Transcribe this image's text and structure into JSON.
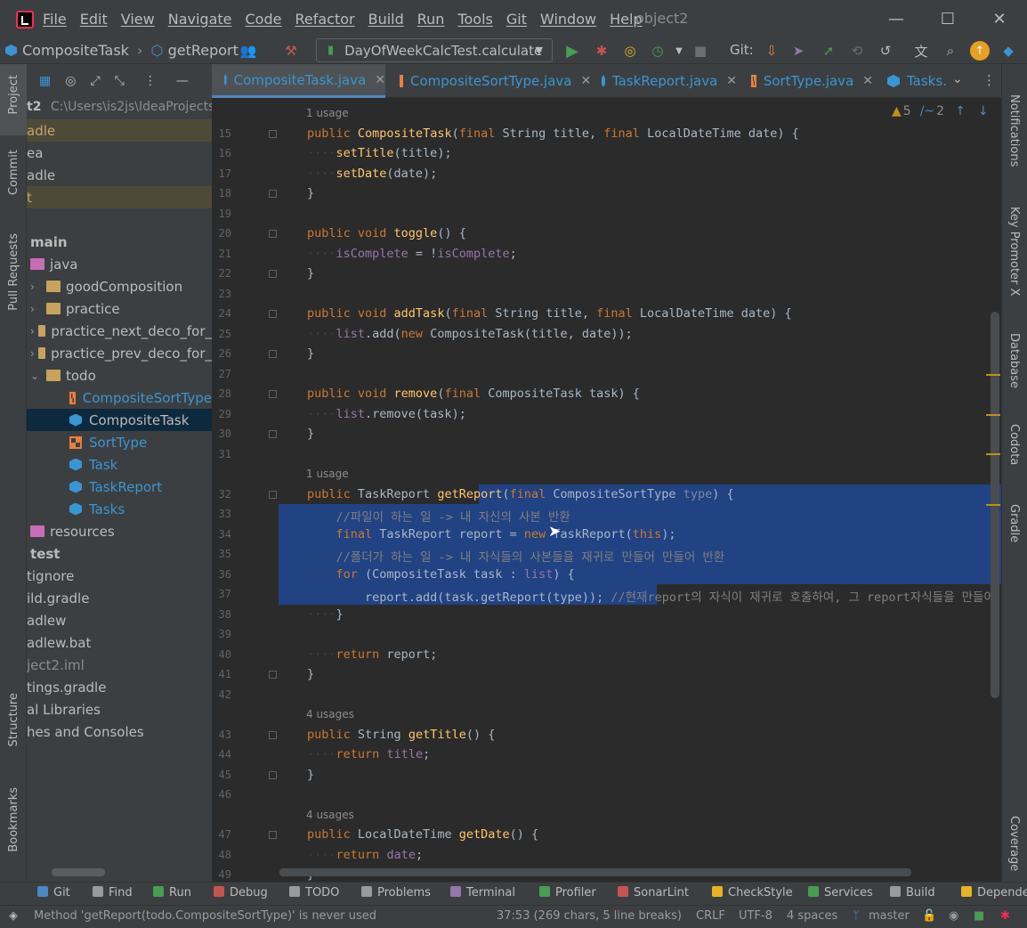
{
  "window": {
    "menu": [
      "File",
      "Edit",
      "View",
      "Navigate",
      "Code",
      "Refactor",
      "Build",
      "Run",
      "Tools",
      "Git",
      "Window",
      "Help"
    ],
    "title": "object2",
    "minimize": "—",
    "maximize": "☐",
    "close": "✕"
  },
  "nav": {
    "crumb_class": "CompositeTask",
    "crumb_sep": "›",
    "crumb_method": "getReport",
    "run_config": "DayOfWeekCalcTest.calculate",
    "git_label": "Git:"
  },
  "left_strip": {
    "project": "Project",
    "commit": "Commit",
    "pull_requests": "Pull Requests",
    "structure": "Structure",
    "bookmarks": "Bookmarks"
  },
  "right_strip": {
    "notifications": "Notifications",
    "key_promoter": "Key Promoter X",
    "database": "Database",
    "codota": "Codota",
    "gradle": "Gradle",
    "coverage": "Coverage"
  },
  "project_tree": {
    "root_prefix": "t2",
    "root_path": "C:\\Users\\is2js\\IdeaProjects",
    "rows": [
      {
        "label": "adle",
        "indent": 0,
        "type": "text",
        "hl": "olive"
      },
      {
        "label": "ea",
        "indent": 0,
        "type": "text",
        "hl": ""
      },
      {
        "label": "adle",
        "indent": 0,
        "type": "text",
        "hl": ""
      },
      {
        "label": "t",
        "indent": 0,
        "type": "text",
        "hl": "olive"
      },
      {
        "label": "",
        "indent": 0,
        "type": "text",
        "hl": ""
      },
      {
        "label": "main",
        "indent": 4,
        "type": "bold",
        "hl": ""
      },
      {
        "label": "java",
        "indent": 4,
        "type": "java-folder",
        "hl": ""
      },
      {
        "label": "goodComposition",
        "indent": 4,
        "type": "folder",
        "arrow": "›",
        "hl": ""
      },
      {
        "label": "practice",
        "indent": 4,
        "type": "folder",
        "arrow": "›",
        "hl": ""
      },
      {
        "label": "practice_next_deco_for_",
        "indent": 4,
        "type": "folder",
        "arrow": "›",
        "hl": ""
      },
      {
        "label": "practice_prev_deco_for_",
        "indent": 4,
        "type": "folder",
        "arrow": "›",
        "hl": ""
      },
      {
        "label": "todo",
        "indent": 4,
        "type": "folder",
        "arrow": "⌄",
        "hl": ""
      },
      {
        "label": "CompositeSortType",
        "indent": 48,
        "type": "enum",
        "hl": ""
      },
      {
        "label": "CompositeTask",
        "indent": 48,
        "type": "class",
        "hl": "sel"
      },
      {
        "label": "SortType",
        "indent": 48,
        "type": "enum",
        "hl": ""
      },
      {
        "label": "Task",
        "indent": 48,
        "type": "class",
        "hl": ""
      },
      {
        "label": "TaskReport",
        "indent": 48,
        "type": "class",
        "hl": ""
      },
      {
        "label": "Tasks",
        "indent": 48,
        "type": "class",
        "hl": ""
      },
      {
        "label": "resources",
        "indent": 4,
        "type": "res-folder",
        "hl": ""
      },
      {
        "label": "test",
        "indent": 4,
        "type": "bold",
        "hl": ""
      },
      {
        "label": "tignore",
        "indent": 0,
        "type": "text",
        "hl": ""
      },
      {
        "label": "ild.gradle",
        "indent": 0,
        "type": "text",
        "hl": ""
      },
      {
        "label": "adlew",
        "indent": 0,
        "type": "text",
        "hl": ""
      },
      {
        "label": "adlew.bat",
        "indent": 0,
        "type": "text",
        "hl": ""
      },
      {
        "label": "ject2.iml",
        "indent": 0,
        "type": "dim",
        "hl": ""
      },
      {
        "label": "tings.gradle",
        "indent": 0,
        "type": "text",
        "hl": ""
      },
      {
        "label": "al Libraries",
        "indent": 0,
        "type": "text",
        "hl": ""
      },
      {
        "label": "hes and Consoles",
        "indent": 0,
        "type": "text",
        "hl": ""
      }
    ]
  },
  "tabs": [
    {
      "label": "CompositeTask.java",
      "icon": "class",
      "active": true
    },
    {
      "label": "CompositeSortType.java",
      "icon": "enum",
      "active": false
    },
    {
      "label": "TaskReport.java",
      "icon": "class",
      "active": false
    },
    {
      "label": "SortType.java",
      "icon": "enum",
      "active": false
    },
    {
      "label": "Tasks.",
      "icon": "class",
      "active": false
    }
  ],
  "inspections": {
    "warnings": "5",
    "typos": "2"
  },
  "code": [
    {
      "kind": "usage",
      "text": "1 usage"
    },
    {
      "n": "15",
      "html": "<span class='k'>public</span> <span class='f'>CompositeTask</span>(<span class='k'>final</span> String title, <span class='k'>final</span> LocalDateTime date) {",
      "fold": true
    },
    {
      "n": "16",
      "html": "<span class='dots'>····</span><span class='f'>setTitle</span>(title);"
    },
    {
      "n": "17",
      "html": "<span class='dots'>····</span><span class='f'>setDate</span>(date);"
    },
    {
      "n": "18",
      "html": "}",
      "fold": true
    },
    {
      "n": "19",
      "html": ""
    },
    {
      "n": "20",
      "html": "<span class='k'>public void</span> <span class='f'>toggle</span>() {",
      "fold": true
    },
    {
      "n": "21",
      "html": "<span class='dots'>····</span><span class='p'>isComplete</span> = !<span class='p'>isComplete</span>;"
    },
    {
      "n": "22",
      "html": "}",
      "fold": true
    },
    {
      "n": "23",
      "html": ""
    },
    {
      "n": "24",
      "html": "<span class='k'>public void</span> <span class='f'>addTask</span>(<span class='k'>final</span> String title, <span class='k'>final</span> LocalDateTime date) {",
      "fold": true
    },
    {
      "n": "25",
      "html": "<span class='dots'>····</span><span class='p'>list</span>.add(<span class='k'>new</span> CompositeTask(title, date));"
    },
    {
      "n": "26",
      "html": "}",
      "fold": true
    },
    {
      "n": "27",
      "html": ""
    },
    {
      "n": "28",
      "html": "<span class='k'>public void</span> <span class='f'>remove</span>(<span class='k'>final</span> CompositeTask task) {",
      "fold": true
    },
    {
      "n": "29",
      "html": "<span class='dots'>····</span><span class='p'>list</span>.remove(task);"
    },
    {
      "n": "30",
      "html": "}",
      "fold": true
    },
    {
      "n": "31",
      "html": ""
    },
    {
      "kind": "usage",
      "text": "1 usage"
    },
    {
      "n": "32",
      "html": "<span class='k'>public</span> TaskReport <span class='f'>getReport</span>(<span class='k'>final</span> CompositeSortType <span class='g'>type</span>) {",
      "fold": true
    },
    {
      "n": "33",
      "html": "<span class='dots'>····</span><span class='c'>//파일이 하는 일 -&gt; 내 자신의 사본 반환</span>"
    },
    {
      "n": "34",
      "html": "<span class='dots'>····</span><span class='k'>final</span> TaskReport report = <span class='k'>new</span> TaskReport(<span class='k'>this</span>);"
    },
    {
      "n": "35",
      "html": "<span class='dots'>····</span><span class='c'>//폴더가 하는 일 -&gt; 내 자식들의 사본들을 재귀로 만들어 만들어 반환</span>"
    },
    {
      "n": "36",
      "html": "<span class='dots'>····</span><span class='k'>for</span> (CompositeTask task : <span class='p'>list</span>) {"
    },
    {
      "n": "37",
      "html": "<span class='dots'>········</span>report.add(task.getReport(type)); <span class='c'>//현재report의 자식이 재귀로 호출하여, 그 report자식들을 만들어</span>"
    },
    {
      "n": "38",
      "html": "<span class='dots'>····</span>}"
    },
    {
      "n": "39",
      "html": ""
    },
    {
      "n": "40",
      "html": "<span class='dots'>····</span><span class='k'>return</span> report;"
    },
    {
      "n": "41",
      "html": "}",
      "fold": true
    },
    {
      "n": "42",
      "html": ""
    },
    {
      "kind": "usage",
      "text": "4 usages"
    },
    {
      "n": "43",
      "html": "<span class='k'>public</span> String <span class='f'>getTitle</span>() {",
      "fold": true
    },
    {
      "n": "44",
      "html": "<span class='dots'>····</span><span class='k'>return</span> <span class='p'>title</span>;"
    },
    {
      "n": "45",
      "html": "}",
      "fold": true
    },
    {
      "n": "46",
      "html": ""
    },
    {
      "kind": "usage",
      "text": "4 usages"
    },
    {
      "n": "47",
      "html": "<span class='k'>public</span> LocalDateTime <span class='f'>getDate</span>() {",
      "fold": true
    },
    {
      "n": "48",
      "html": "<span class='dots'>····</span><span class='k'>return</span> <span class='p'>date</span>;"
    },
    {
      "n": "49",
      "html": "}"
    }
  ],
  "bottom_bar": [
    {
      "label": "Git",
      "color": "#4a88c7"
    },
    {
      "label": "Find",
      "color": "#9a9a9a"
    },
    {
      "label": "Run",
      "color": "#499c54"
    },
    {
      "label": "Debug",
      "color": "#c75450"
    },
    {
      "label": "TODO",
      "color": "#9a9a9a"
    },
    {
      "label": "Problems",
      "color": "#9a9a9a"
    },
    {
      "label": "Terminal",
      "color": "#9876aa"
    },
    {
      "label": "Profiler",
      "color": "#499c54"
    },
    {
      "label": "SonarLint",
      "color": "#c75450"
    },
    {
      "label": "CheckStyle",
      "color": "#e6b422"
    },
    {
      "label": "Services",
      "color": "#499c54"
    },
    {
      "label": "Build",
      "color": "#9a9a9a"
    },
    {
      "label": "Depende",
      "color": "#e6b422"
    }
  ],
  "status": {
    "message": "Method 'getReport(todo.CompositeSortType)' is never used",
    "position": "37:53 (269 chars, 5 line breaks)",
    "line_sep": "CRLF",
    "encoding": "UTF-8",
    "indent": "4 spaces",
    "branch": "master"
  },
  "colors": {
    "accent": "#4a88c7",
    "selection": "#214283",
    "warning": "#be9117"
  }
}
